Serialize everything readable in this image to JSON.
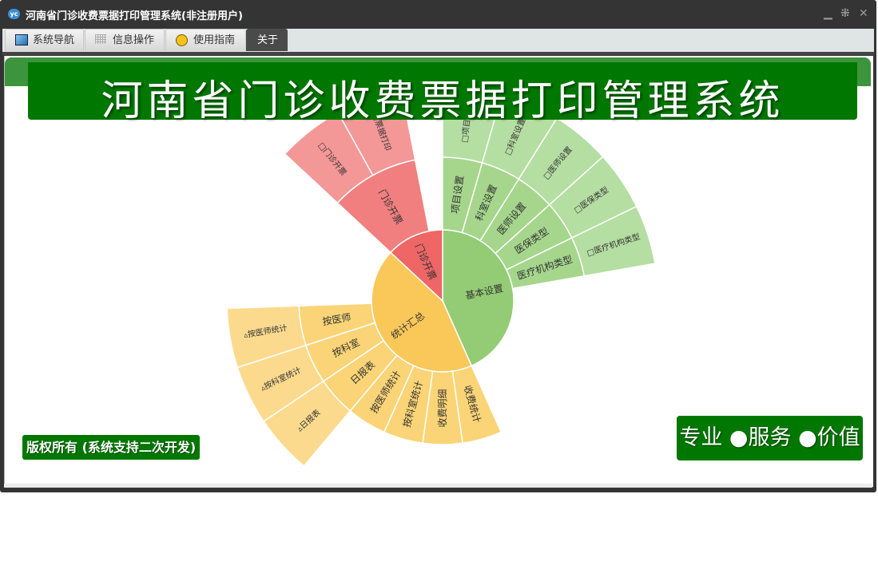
{
  "window": {
    "title": "河南省门诊收费票据打印管理系统(非注册用户)",
    "app_icon_text": "yc",
    "controls": {
      "minimize": "▁",
      "restore": "⁜",
      "close": "✕"
    }
  },
  "tabs": [
    {
      "label": "系统导航",
      "icon": "monitor-icon"
    },
    {
      "label": "信息操作",
      "icon": "grid-icon"
    },
    {
      "label": "使用指南",
      "icon": "help-icon"
    },
    {
      "label": "关于",
      "icon": "",
      "active": true
    }
  ],
  "banner": {
    "title": "河南省门诊收费票据打印管理系统"
  },
  "footer": {
    "copyright": "版权所有 (系统支持二次开发)",
    "slogan": "专业 ●服务 ●价值"
  },
  "colors": {
    "green": "#93cc75",
    "green2": "#a5d68c",
    "green3": "#b5dea2",
    "red": "#ee6666",
    "red2": "#f17f7f",
    "red3": "#f39797",
    "yellow": "#f9c859",
    "yellow2": "#fad476",
    "yellow3": "#fbda8e",
    "brand": "#007800"
  },
  "chart_data": {
    "type": "sunburst",
    "start_angle_deg": 0,
    "nodes": [
      {
        "name": "基本设置",
        "value": 156,
        "color": "green",
        "children": [
          {
            "name": "项目设置",
            "value": 16,
            "children": [
              {
                "name": "□项目设置",
                "value": 16
              }
            ]
          },
          {
            "name": "科室设置",
            "value": 16,
            "children": [
              {
                "name": "□科室设置",
                "value": 16
              }
            ]
          },
          {
            "name": "医师设置",
            "value": 16,
            "children": [
              {
                "name": "□医师设置",
                "value": 16
              }
            ]
          },
          {
            "name": "医保类型",
            "value": 16,
            "children": [
              {
                "name": "□医保类型",
                "value": 16
              }
            ]
          },
          {
            "name": "医疗机构类型",
            "value": 16,
            "children": [
              {
                "name": "□医疗机构类型",
                "value": 16
              }
            ]
          }
        ]
      },
      {
        "name": "统计汇总",
        "value": 157,
        "color": "yellow",
        "children": [
          {
            "name": "收费统计",
            "value": 16,
            "children": []
          },
          {
            "name": "收费明细",
            "value": 16,
            "children": []
          },
          {
            "name": "按科室统计",
            "value": 16,
            "children": []
          },
          {
            "name": "按医师统计",
            "value": 16,
            "children": []
          },
          {
            "name": "日报表",
            "value": 16,
            "children": [
              {
                "name": "▵日报表",
                "value": 16
              }
            ]
          },
          {
            "name": "按科室",
            "value": 16,
            "children": [
              {
                "name": "▵按科室统计",
                "value": 16
              }
            ]
          },
          {
            "name": "按医师",
            "value": 16,
            "children": [
              {
                "name": "▵按医师统计",
                "value": 16
              }
            ]
          }
        ]
      },
      {
        "name": "门诊开票",
        "value": 47,
        "color": "red",
        "children": [
          {
            "name": "门诊开票",
            "value": 36,
            "children": [
              {
                "name": "□门诊开票",
                "value": 18
              },
              {
                "name": "□票据打印",
                "value": 18
              }
            ]
          }
        ]
      }
    ]
  }
}
